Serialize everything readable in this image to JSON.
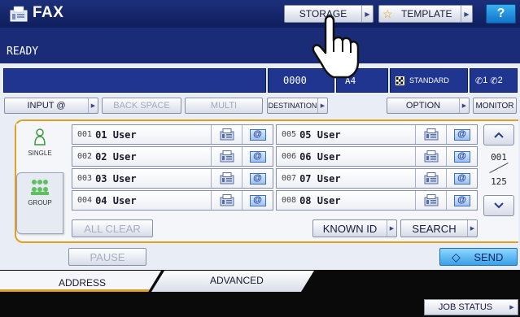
{
  "app": {
    "title": "FAX",
    "status": "READY"
  },
  "top_buttons": {
    "storage": "STORAGE",
    "template": "TEMPLATE",
    "help": "?"
  },
  "info": {
    "count": "0000",
    "paper": "A4",
    "resolution": "STANDARD",
    "lines": "§1 §2",
    "line1": "1",
    "line2": "2"
  },
  "function_buttons": {
    "input": "INPUT @",
    "back_space": "BACK SPACE",
    "multi": "MULTI",
    "destination": "DESTINATION",
    "option": "OPTION",
    "monitor": "MONITOR"
  },
  "side_tabs": {
    "single": "SINGLE",
    "group": "GROUP"
  },
  "users": [
    {
      "num": "001",
      "name": "01 User"
    },
    {
      "num": "002",
      "name": "02 User"
    },
    {
      "num": "003",
      "name": "03 User"
    },
    {
      "num": "004",
      "name": "04 User"
    },
    {
      "num": "005",
      "name": "05 User"
    },
    {
      "num": "006",
      "name": "06 User"
    },
    {
      "num": "007",
      "name": "07 User"
    },
    {
      "num": "008",
      "name": "08 User"
    }
  ],
  "paging": {
    "current": "001",
    "total": "125"
  },
  "panel_buttons": {
    "all_clear": "ALL CLEAR",
    "known_id": "KNOWN ID",
    "search": "SEARCH",
    "pause": "PAUSE",
    "send": "SEND"
  },
  "bottom_tabs": {
    "address": "ADDRESS",
    "advanced": "ADVANCED"
  },
  "job_status": "JOB STATUS",
  "colors": {
    "title_bar": "#1c2f7a",
    "accent": "#e0a020",
    "send": "#3aa0e8"
  },
  "icons": {
    "fax": "fax-machine-icon",
    "email": "at-sign-icon",
    "pointer": "hand-pointer-icon"
  }
}
